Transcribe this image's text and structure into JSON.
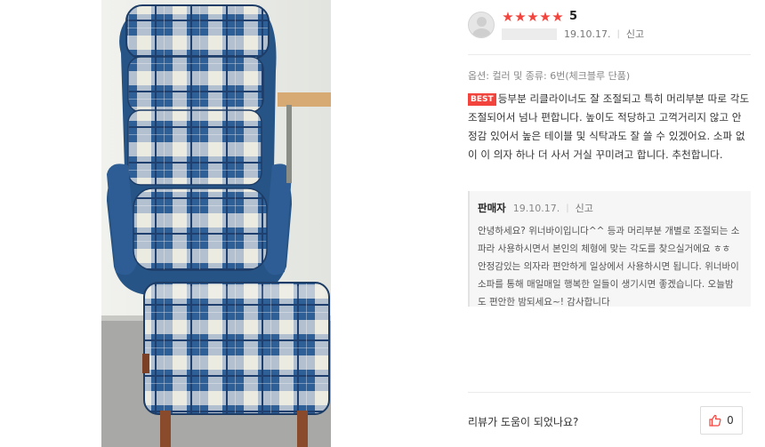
{
  "photo": {
    "icon": "chair-photo",
    "colors": {
      "navy": "#2f5f97",
      "cream": "#e6e3d6",
      "wall": "#eef0ec",
      "floor": "#a8a9a6",
      "wood": "#d7aa73",
      "legs": "#8a4b2c"
    }
  },
  "review": {
    "avatar_icon": "user-avatar-icon",
    "stars": [
      "★",
      "★",
      "★",
      "★",
      "★"
    ],
    "star_color": "#f2443d",
    "score": "5",
    "date": "19.10.17.",
    "report_label": "신고",
    "option_text": "옵션: 컬러 및 종류: 6번(체크블루 단품)",
    "best_badge": "BEST",
    "content": "등부분 리클라이너도 잘 조절되고 특히 머리부분 따로 각도 조절되어서 넘나 편합니다. 높이도 적당하고 고꺽거리지 않고 안정감 있어서 높은 테이블 및 식탁과도 잘 쓸 수 있겠어요. 소파 없이 이 의자 하나 더 사서 거실 꾸미려고 합니다. 추천합니다.",
    "reply": {
      "author": "판매자",
      "date": "19.10.17.",
      "report_label": "신고",
      "content": "안녕하세요? 위너바이입니다^^ 등과 머리부분 개별로 조절되는 소파라 사용하시면서 본인의 체형에 맞는 각도를 찾으실거에요 ㅎㅎ 안정감있는 의자라 편안하게 일상에서 사용하시면 됩니다. 위너바이 소파를 통해 매일매일 행복한 일들이 생기시면 좋겠습니다. 오늘밤도 편안한 밤되세요~! 감사합니다"
    },
    "helpful_question": "리뷰가 도움이 되었나요?",
    "like_icon": "thumbs-up-icon",
    "like_count": "0"
  }
}
